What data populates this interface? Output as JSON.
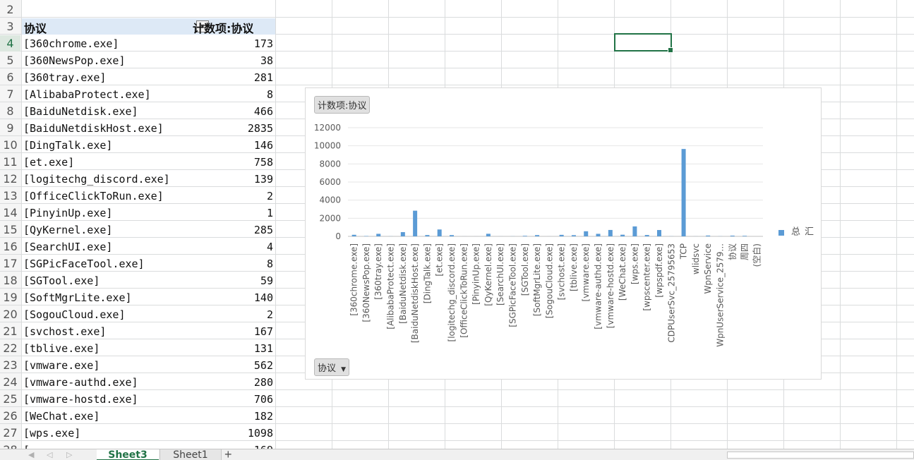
{
  "sheet": {
    "header_row": 3,
    "header_col1": "协议",
    "header_col2": "计数项:协议",
    "filter_icon": "dropdown-arrow-icon",
    "rows": [
      {
        "row": 4,
        "label": "[360chrome.exe]",
        "value": "173"
      },
      {
        "row": 5,
        "label": "[360NewsPop.exe]",
        "value": "38"
      },
      {
        "row": 6,
        "label": "[360tray.exe]",
        "value": "281"
      },
      {
        "row": 7,
        "label": "[AlibabaProtect.exe]",
        "value": "8"
      },
      {
        "row": 8,
        "label": "[BaiduNetdisk.exe]",
        "value": "466"
      },
      {
        "row": 9,
        "label": "[BaiduNetdiskHost.exe]",
        "value": "2835"
      },
      {
        "row": 10,
        "label": "[DingTalk.exe]",
        "value": "146"
      },
      {
        "row": 11,
        "label": "[et.exe]",
        "value": "758"
      },
      {
        "row": 12,
        "label": "[logitechg_discord.exe]",
        "value": "139"
      },
      {
        "row": 13,
        "label": "[OfficeClickToRun.exe]",
        "value": "2"
      },
      {
        "row": 14,
        "label": "[PinyinUp.exe]",
        "value": "1"
      },
      {
        "row": 15,
        "label": "[QyKernel.exe]",
        "value": "285"
      },
      {
        "row": 16,
        "label": "[SearchUI.exe]",
        "value": "4"
      },
      {
        "row": 17,
        "label": "[SGPicFaceTool.exe]",
        "value": "8"
      },
      {
        "row": 18,
        "label": "[SGTool.exe]",
        "value": "59"
      },
      {
        "row": 19,
        "label": "[SoftMgrLite.exe]",
        "value": "140"
      },
      {
        "row": 20,
        "label": "[SogouCloud.exe]",
        "value": "2"
      },
      {
        "row": 21,
        "label": "[svchost.exe]",
        "value": "167"
      },
      {
        "row": 22,
        "label": "[tblive.exe]",
        "value": "131"
      },
      {
        "row": 23,
        "label": "[vmware.exe]",
        "value": "562"
      },
      {
        "row": 24,
        "label": "[vmware-authd.exe]",
        "value": "280"
      },
      {
        "row": 25,
        "label": "[vmware-hostd.exe]",
        "value": "706"
      },
      {
        "row": 26,
        "label": "[WeChat.exe]",
        "value": "182"
      },
      {
        "row": 27,
        "label": "[wps.exe]",
        "value": "1098"
      }
    ],
    "visible_row_numbers": [
      "2",
      "3",
      "4",
      "5",
      "6",
      "7",
      "8",
      "9",
      "10",
      "11",
      "12",
      "13",
      "14",
      "15",
      "16",
      "17",
      "18",
      "19",
      "20",
      "21",
      "22",
      "23",
      "24",
      "25",
      "26",
      "27",
      "28"
    ],
    "partial_row": {
      "row": 28,
      "label": "[",
      "value": "169"
    },
    "active_row": "4"
  },
  "chart": {
    "field_button": "计数项:协议",
    "axis_button": "协议",
    "axis_button_icon": "dropdown-arrow-icon",
    "legend_label": "汇总",
    "bar_color": "#5b9bd5"
  },
  "chart_data": {
    "type": "bar",
    "ylim": [
      0,
      12000
    ],
    "yticks": [
      "0",
      "2000",
      "4000",
      "6000",
      "8000",
      "10000",
      "12000"
    ],
    "categories": [
      "[360chrome.exe]",
      "[360NewsPop.exe]",
      "[360tray.exe]",
      "[AlibabaProtect.exe]",
      "[BaiduNetdisk.exe]",
      "[BaiduNetdiskHost.exe]",
      "[DingTalk.exe]",
      "[et.exe]",
      "[logitechg_discord.exe]",
      "[OfficeClickToRun.exe]",
      "[PinyinUp.exe]",
      "[QyKernel.exe]",
      "[SearchUI.exe]",
      "[SGPicFaceTool.exe]",
      "[SGTool.exe]",
      "[SoftMgrLite.exe]",
      "[SogouCloud.exe]",
      "[svchost.exe]",
      "[tblive.exe]",
      "[vmware.exe]",
      "[vmware-authd.exe]",
      "[vmware-hostd.exe]",
      "[WeChat.exe]",
      "[wps.exe]",
      "[wpscenter.exe]",
      "[wpspdf.exe]",
      "CDPUserSvc_25795653",
      "TCP",
      "wlidsvc",
      "WpnService",
      "WpnUserService_2579...",
      "协议",
      "周四",
      "(空白)"
    ],
    "series": [
      {
        "name": "汇总",
        "values": [
          173,
          38,
          281,
          8,
          466,
          2835,
          146,
          758,
          139,
          2,
          1,
          285,
          4,
          8,
          59,
          140,
          2,
          167,
          131,
          562,
          280,
          706,
          182,
          1098,
          150,
          700,
          10,
          9650,
          5,
          90,
          10,
          80,
          60,
          0
        ]
      }
    ],
    "legend": "right"
  },
  "tabs": {
    "sheet3": "Sheet3",
    "sheet1": "Sheet1",
    "add_icon": "+"
  }
}
